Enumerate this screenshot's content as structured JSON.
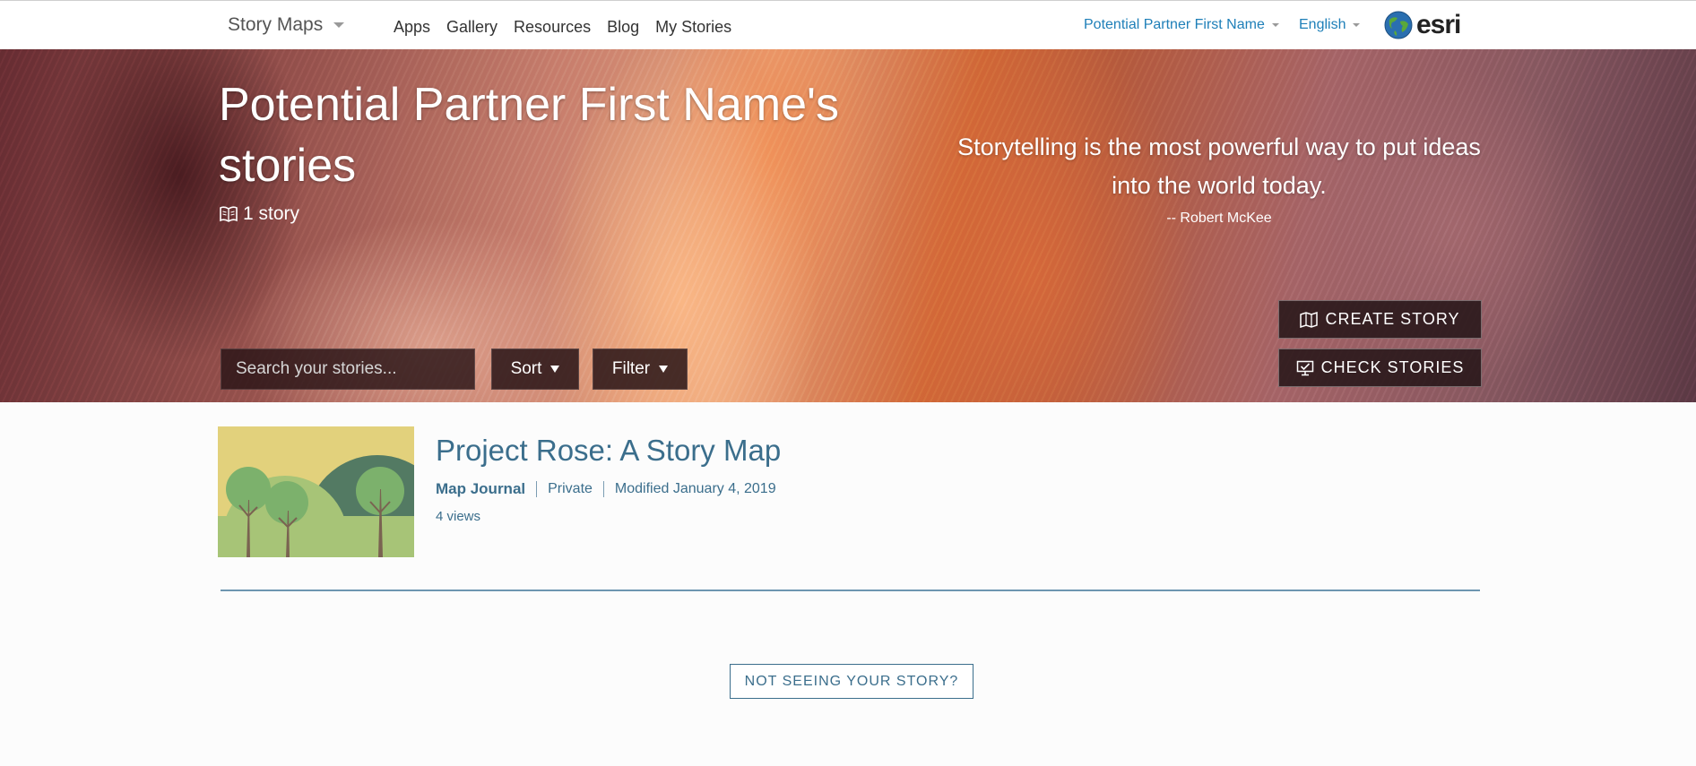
{
  "nav": {
    "brand": "Story Maps",
    "links": [
      "Apps",
      "Gallery",
      "Resources",
      "Blog",
      "My Stories"
    ],
    "user_name": "Potential Partner First Name",
    "language": "English",
    "logo_text": "esri"
  },
  "hero": {
    "title": "Potential Partner First Name's stories",
    "story_count": "1 story",
    "quote": "Storytelling is the most powerful way to put ideas into the world today.",
    "quote_author": "-- Robert McKee",
    "search_placeholder": "Search your stories...",
    "sort_label": "Sort",
    "filter_label": "Filter",
    "create_label": "CREATE STORY",
    "check_label": "CHECK STORIES"
  },
  "stories": [
    {
      "title": "Project Rose: A Story Map",
      "type": "Map Journal",
      "access": "Private",
      "modified": "Modified January 4, 2019",
      "views": "4 views"
    }
  ],
  "footer": {
    "not_seeing_label": "NOT SEEING YOUR STORY?"
  },
  "colors": {
    "link": "#1e7fb8",
    "story_text": "#3b6e8c",
    "divider": "#6e96b0"
  }
}
